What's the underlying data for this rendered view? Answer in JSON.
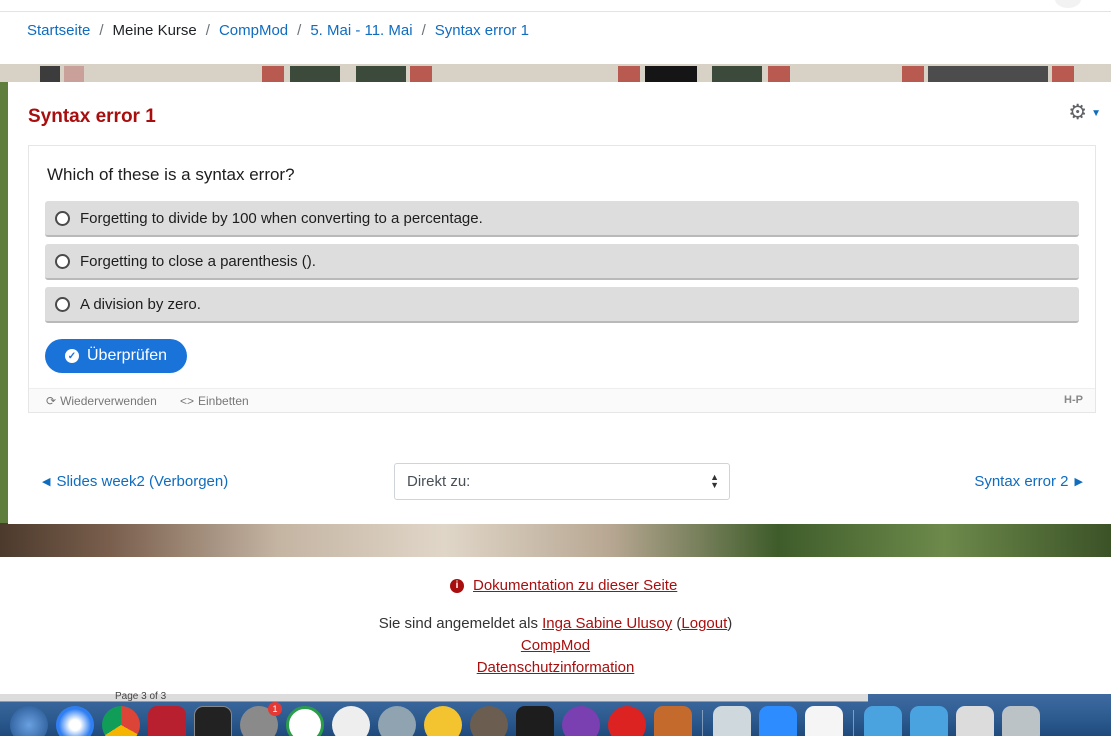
{
  "breadcrumb": {
    "items": [
      "Startseite",
      "Meine Kurse",
      "CompMod",
      "5. Mai - 11. Mai",
      "Syntax error 1"
    ],
    "separator": "/"
  },
  "page": {
    "title": "Syntax error 1"
  },
  "question": {
    "prompt": "Which of these is a syntax error?",
    "options": [
      "Forgetting to divide by 100 when converting to a percentage.",
      "Forgetting to close a parenthesis ().",
      "A division by zero."
    ],
    "check_label": "Überprüfen"
  },
  "h5p_footer": {
    "reuse_label": "Wiederverwenden",
    "embed_label": "Einbetten",
    "logo": "H-P"
  },
  "activity_nav": {
    "prev_label": "Slides week2 (Verborgen)",
    "jump_placeholder": "Direkt zu:",
    "next_label": "Syntax error 2"
  },
  "footer": {
    "doc_link": "Dokumentation zu dieser Seite",
    "logged_in_prefix": "Sie sind angemeldet als",
    "user_name": "Inga Sabine Ulusoy",
    "logout_label": "Logout",
    "course_link": "CompMod",
    "privacy_link": "Datenschutzinformation"
  },
  "dock": {
    "page_label": "Page 3 of 3",
    "badge_count": "1"
  },
  "colors": {
    "title_red": "#a90e0e",
    "link_blue": "#0f6cbf",
    "button_blue": "#1a73d9",
    "option_gray": "#dddddd"
  }
}
